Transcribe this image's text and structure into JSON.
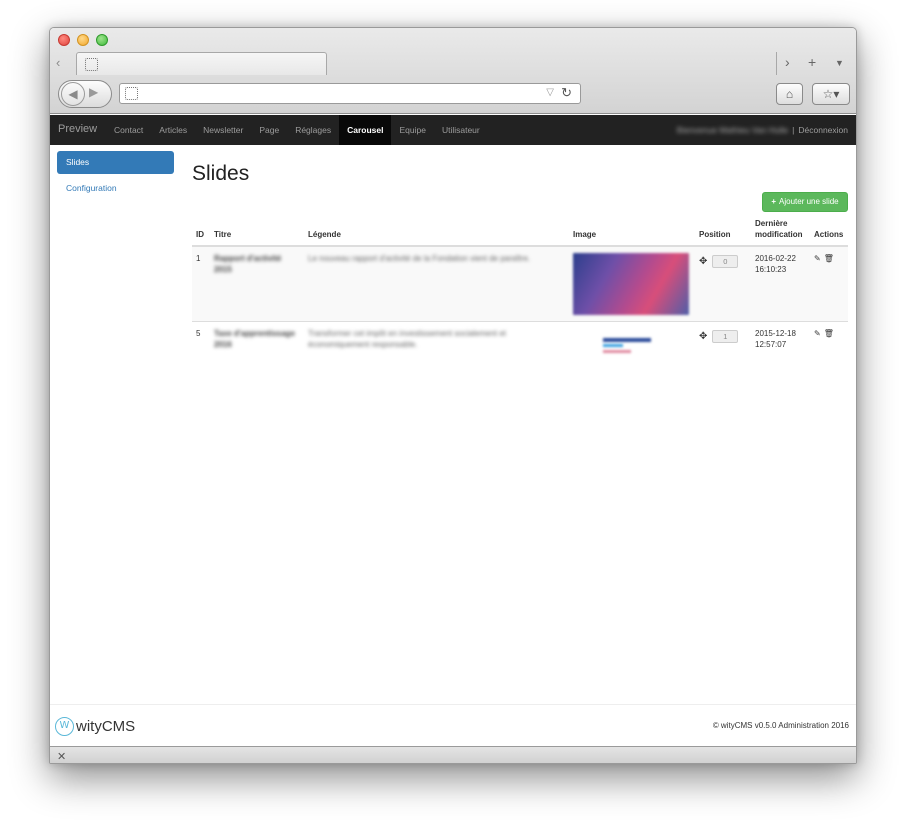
{
  "browser": {
    "url": "",
    "icons": {
      "back": "back-arrow",
      "forward": "forward-arrow",
      "reload": "reload-icon",
      "home": "home-icon",
      "bookmarks": "bookmark-star-icon"
    }
  },
  "nav": {
    "brand": "Preview",
    "items": [
      {
        "label": "Contact"
      },
      {
        "label": "Articles"
      },
      {
        "label": "Newsletter"
      },
      {
        "label": "Page"
      },
      {
        "label": "Réglages"
      },
      {
        "label": "Carousel",
        "active": true
      },
      {
        "label": "Equipe"
      },
      {
        "label": "Utilisateur"
      }
    ],
    "welcome": "Bienvenue Mathieu Van Hulle",
    "separator": "|",
    "logout": "Déconnexion"
  },
  "sidebar": {
    "items": [
      {
        "label": "Slides",
        "active": true
      },
      {
        "label": "Configuration"
      }
    ]
  },
  "main": {
    "title": "Slides",
    "add_button": "Ajouter une slide",
    "columns": {
      "id": "ID",
      "title": "Titre",
      "caption": "Légende",
      "image": "Image",
      "position": "Position",
      "modified": "Dernière modification",
      "actions": "Actions"
    },
    "rows": [
      {
        "id": "1",
        "title": "Rapport d'activité 2015",
        "caption": "Le nouveau rapport d'activité de la Fondation vient de paraître.",
        "position": "0",
        "date": "2016-02-22",
        "time": "16:10:23"
      },
      {
        "id": "5",
        "title": "Taxe d'apprentissage 2016",
        "caption": "Transformer cet impôt en investissement socialement et économiquement responsable.",
        "position": "1",
        "date": "2015-12-18",
        "time": "12:57:07"
      }
    ]
  },
  "footer": {
    "logo_text": "wityCMS",
    "copyright": "© wityCMS v0.5.0 Administration 2016"
  },
  "colors": {
    "nav_bg": "#222222",
    "primary": "#337ab7",
    "success": "#5cb85c"
  }
}
